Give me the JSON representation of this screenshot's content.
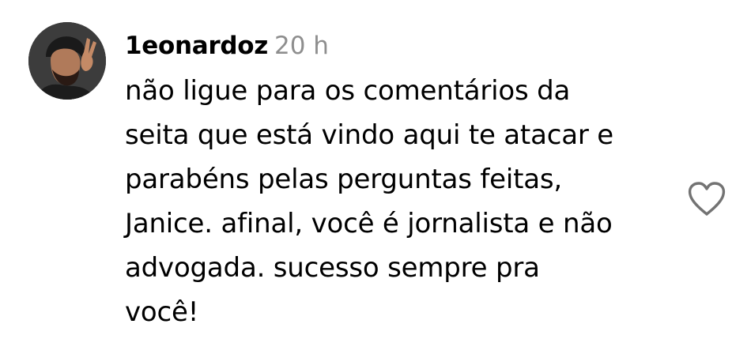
{
  "comment": {
    "username": "1eonardoz",
    "time": "20 h",
    "lines": [
      "não ligue para os comentários da",
      "seita que está vindo aqui te atacar e",
      "parabéns pelas perguntas feitas,",
      "Janice. afinal, você é jornalista e não",
      "advogada. sucesso sempre pra",
      "você!"
    ],
    "avatar_icon": "user-avatar-photo",
    "like_icon": "heart-outline-icon"
  },
  "colors": {
    "text": "#000000",
    "meta": "#8e8e8e",
    "icon": "#737373"
  }
}
